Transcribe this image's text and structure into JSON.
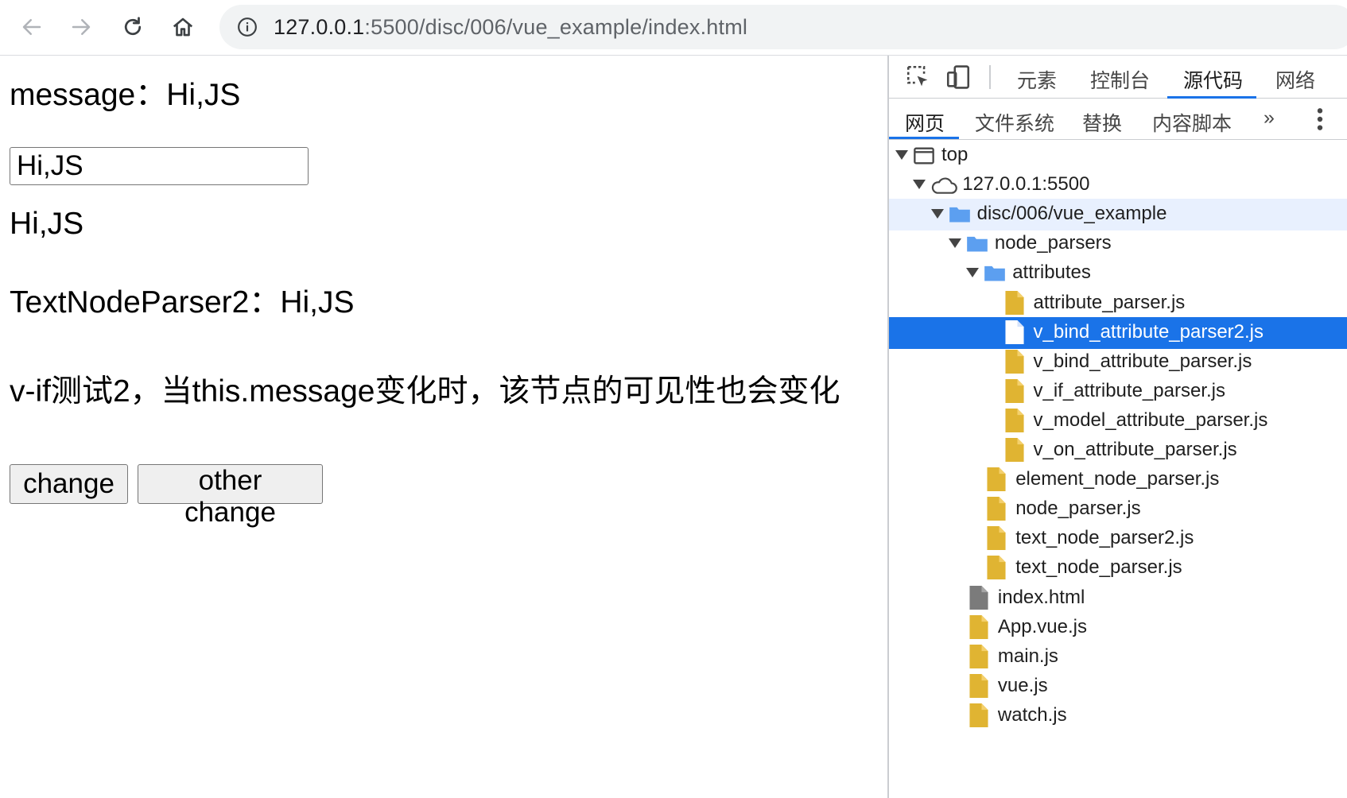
{
  "browser": {
    "url_host": "127.0.0.1",
    "url_rest": ":5500/disc/006/vue_example/index.html",
    "back_icon": "back-arrow-icon",
    "forward_icon": "forward-arrow-icon",
    "reload_icon": "reload-icon",
    "home_icon": "home-icon",
    "info_icon": "info-icon"
  },
  "page": {
    "message_line": "message：Hi,JS",
    "input_value": "Hi,JS",
    "echo_line": "Hi,JS",
    "parser_line": "TextNodeParser2：Hi,JS",
    "vif_text": "v-if测试2，当this.message变化时，该节点的可见性也会变化",
    "change_label": "change",
    "other_change_label": "other change"
  },
  "devtools": {
    "tabs": [
      "元素",
      "控制台",
      "源代码",
      "网络"
    ],
    "active_tab": "源代码",
    "subtabs": [
      "网页",
      "文件系统",
      "替换",
      "内容脚本"
    ],
    "more_label": "»",
    "tree": [
      {
        "label": "top",
        "indent": 0,
        "icon": "frame",
        "expanded": true
      },
      {
        "label": "127.0.0.1:5500",
        "indent": 1,
        "icon": "cloud",
        "expanded": true
      },
      {
        "label": "disc/006/vue_example",
        "indent": 2,
        "icon": "folder",
        "expanded": true,
        "highlight": true
      },
      {
        "label": "node_parsers",
        "indent": 3,
        "icon": "folder",
        "expanded": true
      },
      {
        "label": "attributes",
        "indent": 4,
        "icon": "folder",
        "expanded": true
      },
      {
        "label": "attribute_parser.js",
        "indent": 5,
        "icon": "js"
      },
      {
        "label": "v_bind_attribute_parser2.js",
        "indent": 5,
        "icon": "js",
        "selected": true
      },
      {
        "label": "v_bind_attribute_parser.js",
        "indent": 5,
        "icon": "js"
      },
      {
        "label": "v_if_attribute_parser.js",
        "indent": 5,
        "icon": "js"
      },
      {
        "label": "v_model_attribute_parser.js",
        "indent": 5,
        "icon": "js"
      },
      {
        "label": "v_on_attribute_parser.js",
        "indent": 5,
        "icon": "js"
      },
      {
        "label": "element_node_parser.js",
        "indent": 4,
        "icon": "js"
      },
      {
        "label": "node_parser.js",
        "indent": 4,
        "icon": "js"
      },
      {
        "label": "text_node_parser2.js",
        "indent": 4,
        "icon": "js"
      },
      {
        "label": "text_node_parser.js",
        "indent": 4,
        "icon": "js"
      },
      {
        "label": "index.html",
        "indent": 3,
        "icon": "html"
      },
      {
        "label": "App.vue.js",
        "indent": 3,
        "icon": "js"
      },
      {
        "label": "main.js",
        "indent": 3,
        "icon": "js"
      },
      {
        "label": "vue.js",
        "indent": 3,
        "icon": "js"
      },
      {
        "label": "watch.js",
        "indent": 3,
        "icon": "js"
      }
    ]
  },
  "colors": {
    "accent": "#1a73e8",
    "folder": "#5c9ff0",
    "js_file": "#e0b432",
    "html_file": "#7b7b7b"
  }
}
